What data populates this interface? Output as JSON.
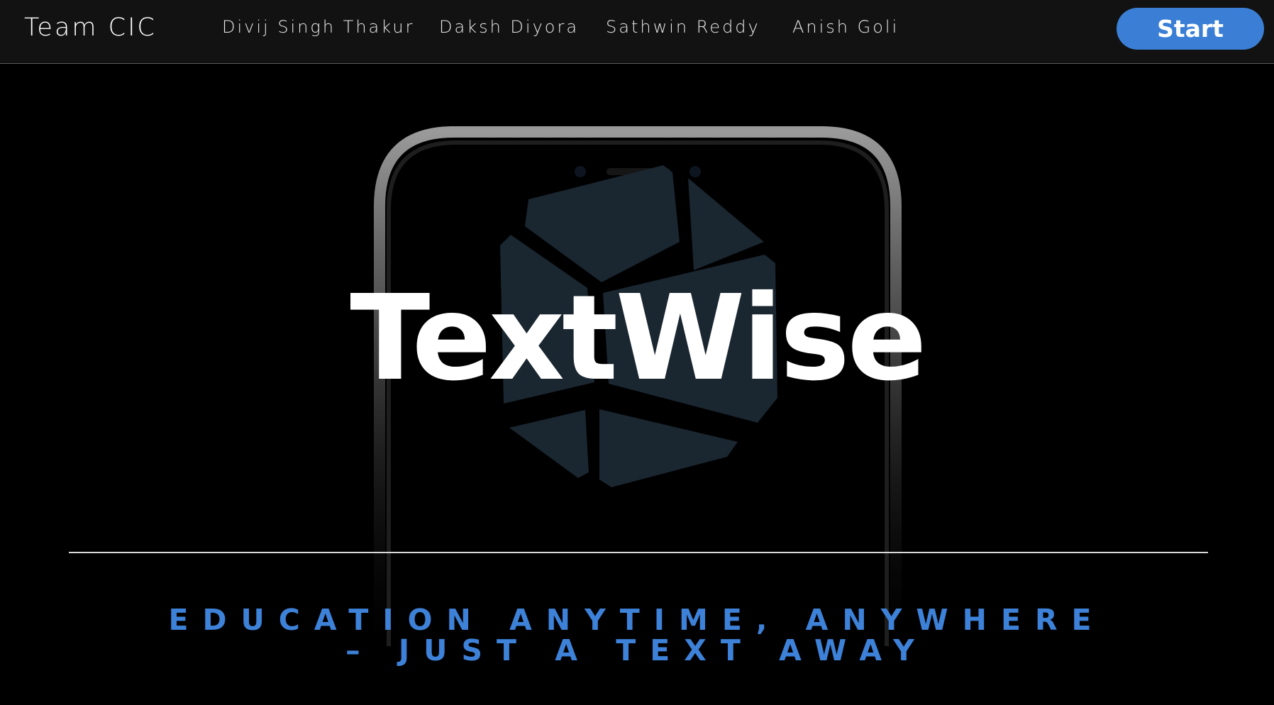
{
  "navbar": {
    "brand": "Team CIC",
    "links": [
      "Divij Singh Thakur",
      "Daksh Diyora",
      "Sathwin Reddy",
      "Anish Goli"
    ],
    "start_label": "Start"
  },
  "hero": {
    "title": "TextWise",
    "tagline_line1": "EDUCATION ANYTIME, ANYWHERE",
    "tagline_line2": "– JUST A TEXT AWAY"
  },
  "colors": {
    "accent": "#3a7fd5",
    "navbar_bg": "#121212",
    "page_bg": "#000000",
    "logo_tint": "#1a2630"
  },
  "icons": {
    "hero_device": "phone-icon",
    "hero_logo": "cube-logo-icon"
  }
}
